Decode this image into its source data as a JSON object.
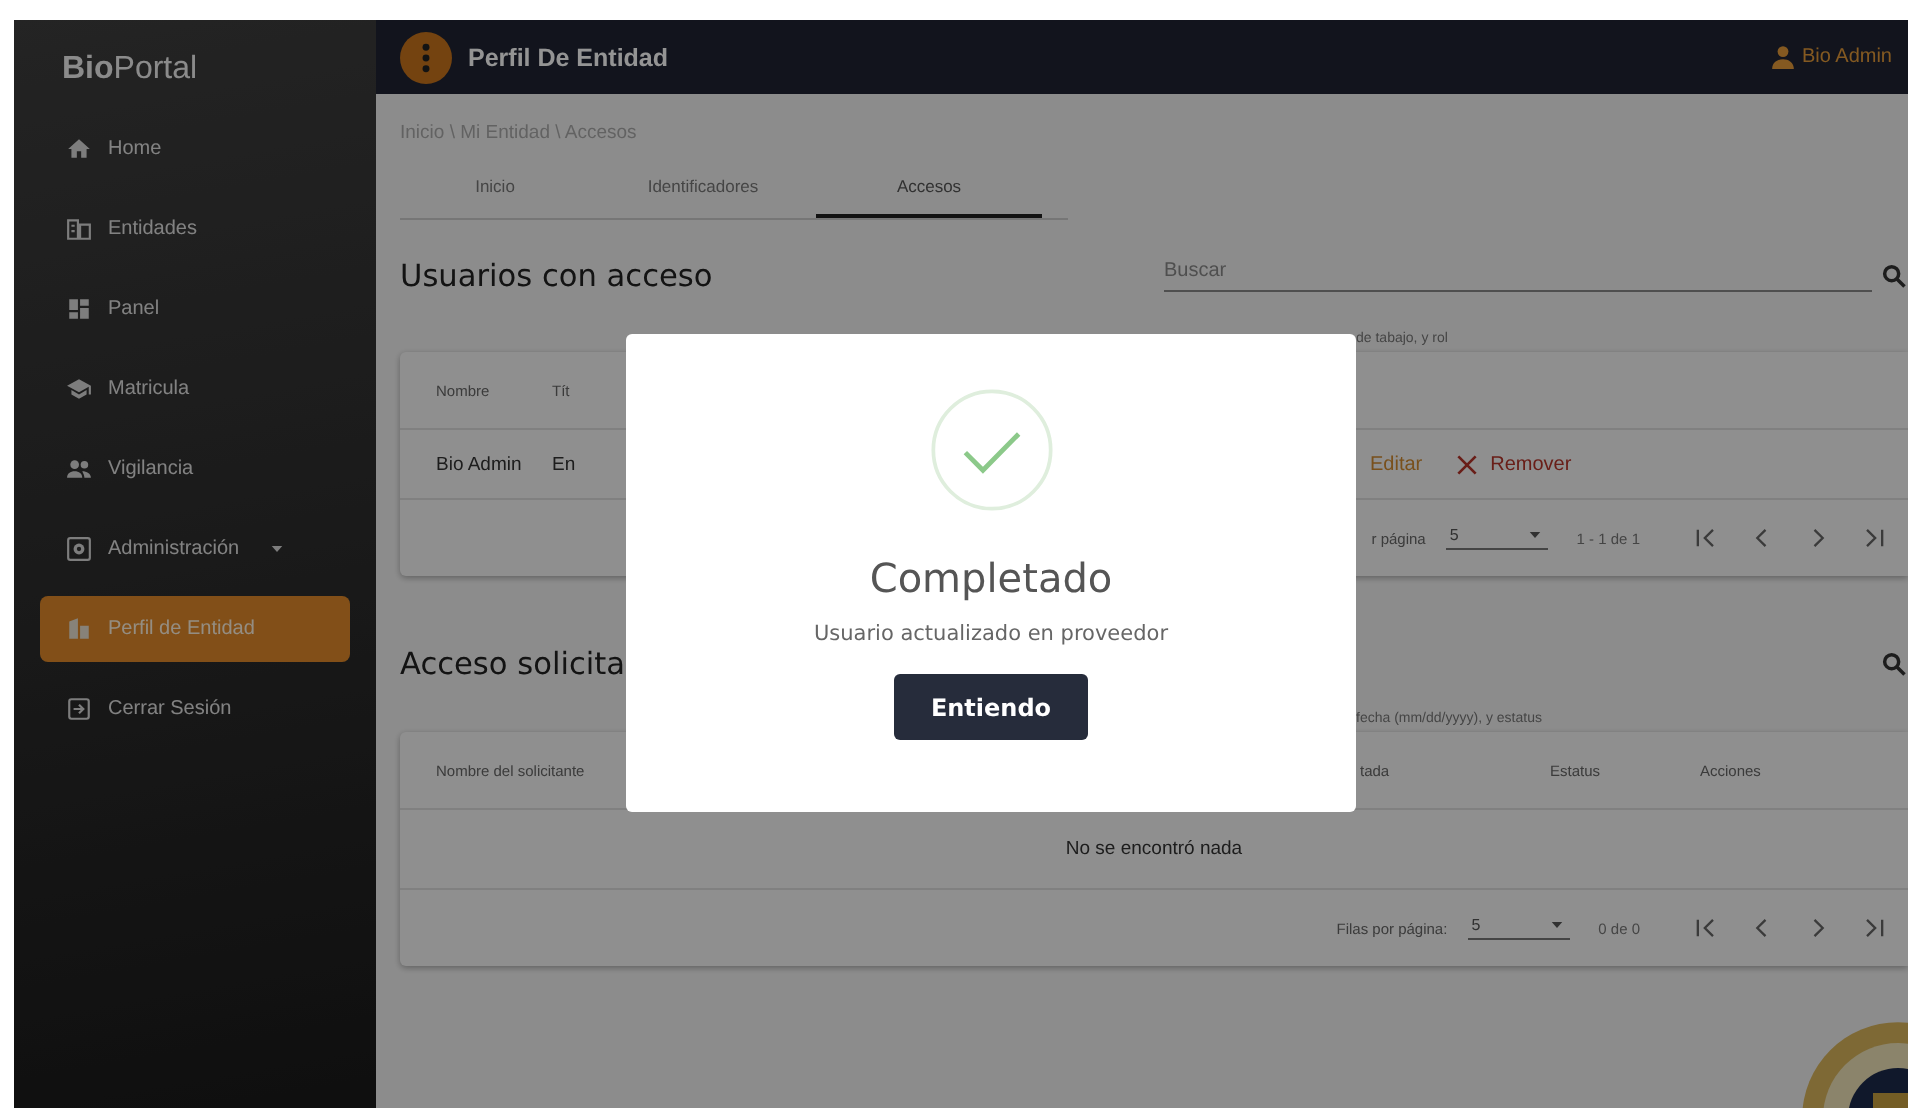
{
  "sidebar": {
    "logo": "**Bio**Portal",
    "items": [
      {
        "label": "Home",
        "has_menu": false,
        "selected": false
      },
      {
        "label": "Entidades",
        "has_menu": false,
        "selected": false
      },
      {
        "label": "Panel",
        "has_menu": false,
        "selected": false
      },
      {
        "label": "Matricula",
        "has_menu": false,
        "selected": false
      },
      {
        "label": "Vigilancia",
        "has_menu": false,
        "selected": false
      },
      {
        "label": "Administración",
        "has_menu": true,
        "selected": false
      },
      {
        "label": "Perfil de Entidad",
        "has_menu": false,
        "selected": true
      },
      {
        "label": "Cerrar Sesión",
        "has_menu": false,
        "selected": false
      }
    ]
  },
  "topbar": {
    "title": "Perfil De Entidad",
    "user": "Bio Admin"
  },
  "breadcrumb": "Inicio \\ Mi Entidad \\ Accesos",
  "tabs": [
    {
      "label": "Inicio",
      "selected": false
    },
    {
      "label": "Identificadores",
      "selected": false
    },
    {
      "label": "Accesos",
      "selected": true
    }
  ],
  "users_section": {
    "heading": "Usuarios con acceso",
    "search": {
      "placeholder": "Buscar",
      "helper": "de tabajo, y rol"
    },
    "table": {
      "columns": [
        "Nombre",
        "Tít"
      ],
      "rows": [
        {
          "cells": [
            "Bio Admin",
            "En"
          ],
          "actions": [
            {
              "kind": "edit",
              "label": "Editar"
            },
            {
              "kind": "remove",
              "label": "Remover"
            }
          ]
        }
      ]
    },
    "pager": {
      "rows_label": "r página",
      "rows_value": "5",
      "range": "1 - 1 de 1"
    }
  },
  "requests_section": {
    "heading": "Acceso solicita",
    "search": {
      "helper": "fecha (mm/dd/yyyy), y estatus"
    },
    "table": {
      "columns": [
        "Nombre del solicitante",
        "tada",
        "Estatus",
        "Acciones"
      ],
      "empty": "No se encontró nada"
    },
    "pager": {
      "rows_label": "Filas por página:",
      "rows_value": "5",
      "range": "0 de 0"
    }
  },
  "dialog": {
    "title": "Completado",
    "message": "Usuario actualizado en proveedor",
    "button": "Entiendo"
  }
}
